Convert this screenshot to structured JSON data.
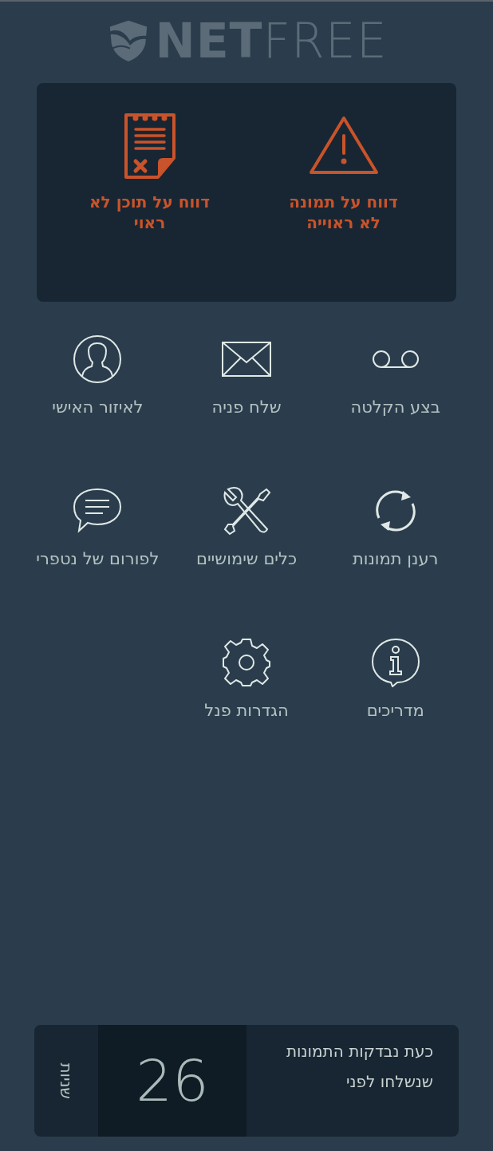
{
  "logo": {
    "text": "**NET**FREE"
  },
  "report_actions": [
    {
      "kind": "warning",
      "label": "דווח על תמונה לא ראוייה"
    },
    {
      "kind": "document",
      "label": "דווח על תוכן לא ראוי"
    }
  ],
  "menu_items": [
    {
      "kind": "voicemail",
      "label": "בצע הקלטה"
    },
    {
      "kind": "envelope",
      "label": "שלח פניה"
    },
    {
      "kind": "user",
      "label": "לאיזור האישי"
    },
    {
      "kind": "refresh",
      "label": "רענן תמונות"
    },
    {
      "kind": "tools",
      "label": "כלים שימושיים"
    },
    {
      "kind": "chat",
      "label": "לפורום של נטפרי"
    },
    {
      "kind": "info",
      "label": "מדריכים"
    },
    {
      "kind": "gear",
      "label": "הגדרות פנל"
    }
  ],
  "status": {
    "message": "כעת נבדקות התמונות שנשלחו לפני",
    "count": "26",
    "unit": "שניות"
  }
}
